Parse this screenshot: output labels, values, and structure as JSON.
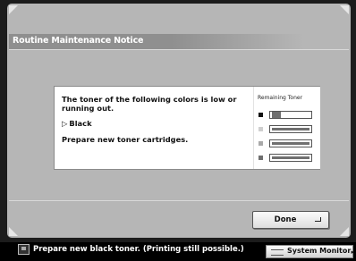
{
  "dialog": {
    "title": "Routine Maintenance Notice",
    "message": "The toner of the following colors is low or running out.",
    "color_item": "Black",
    "instruction": "Prepare new toner cartridges."
  },
  "remaining_toner": {
    "title": "Remaining Toner",
    "cartridges": [
      {
        "color": "#111111",
        "level_fraction": 0.22
      },
      {
        "color": "#cfcfcf",
        "level_fraction": 1.0
      },
      {
        "color": "#a9a9a9",
        "level_fraction": 1.0
      },
      {
        "color": "#6e6e6e",
        "level_fraction": 1.0
      }
    ]
  },
  "buttons": {
    "done_label": "Done"
  },
  "status_bar": {
    "message": "Prepare new black toner. (Printing still possible.)",
    "system_monitor_label": "System Monitor"
  },
  "icons": {
    "triangle": "▷",
    "status_icon": "toner-warning-icon",
    "enter_icon": "enter-icon",
    "sysmon_arrow": "▸"
  },
  "colors": {
    "panel": "#b6b6b6",
    "background": "#1c1c1c",
    "titlebar": "#8f8f8f"
  }
}
